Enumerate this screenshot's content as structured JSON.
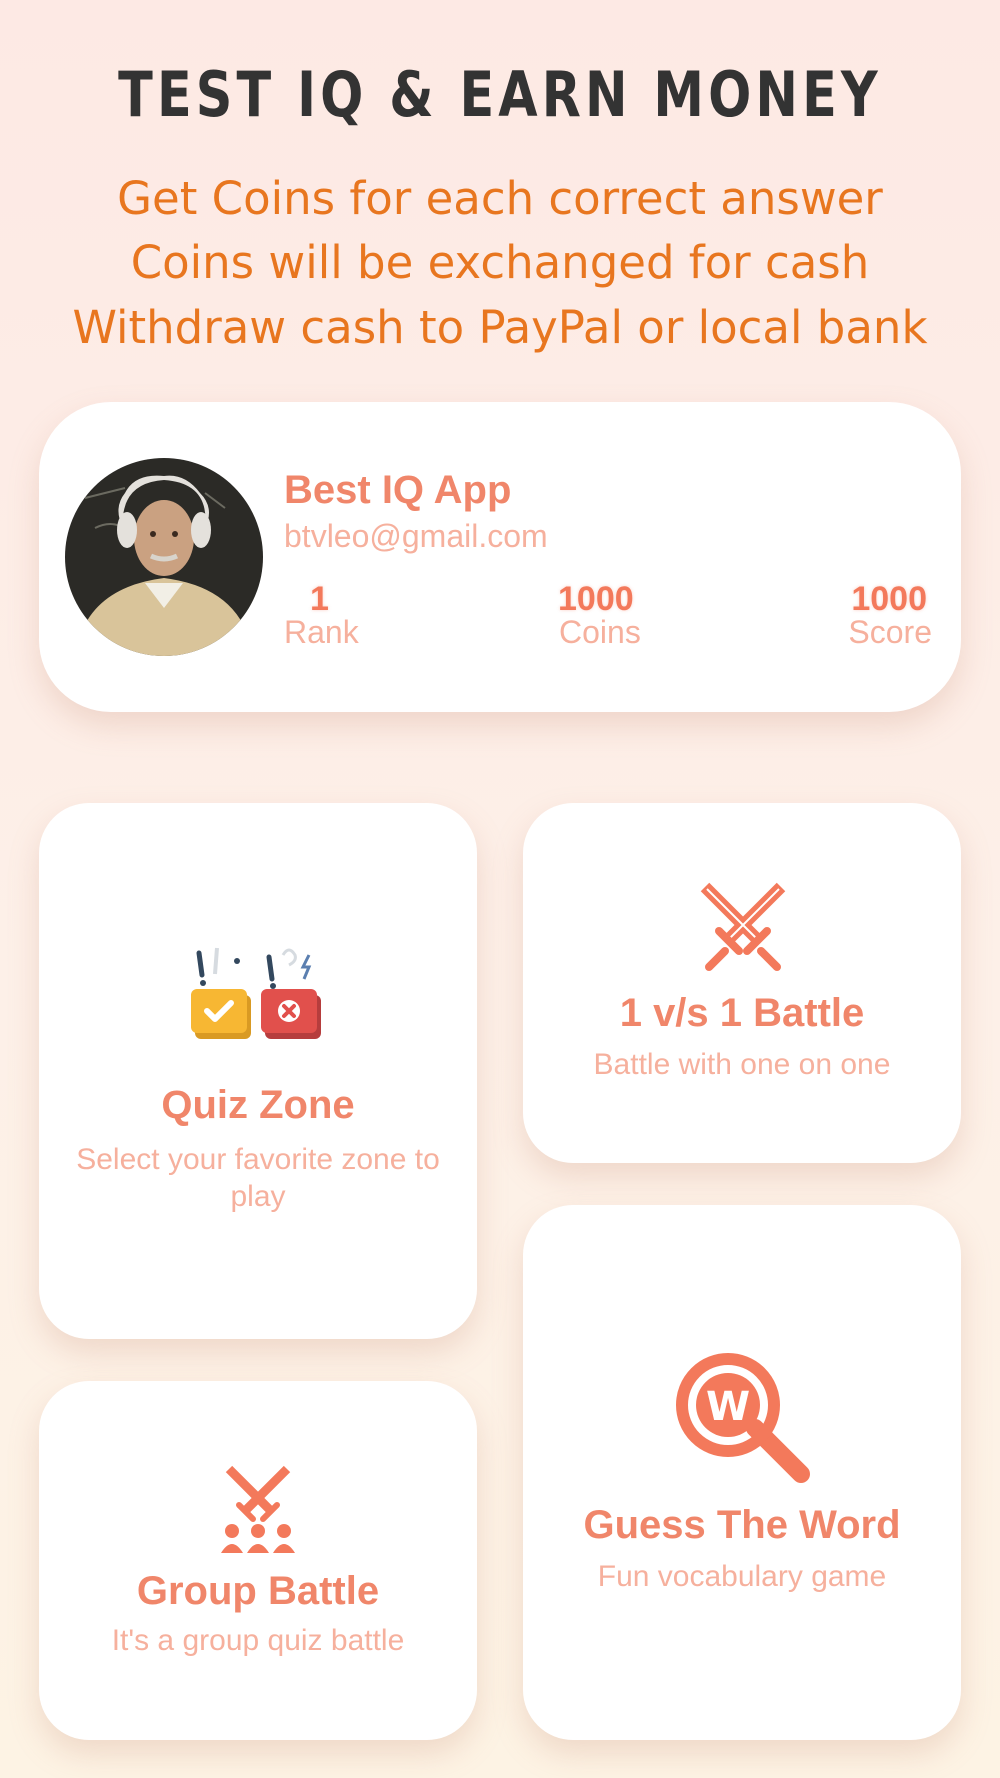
{
  "headline": "TEST IQ & EARN MONEY",
  "subheadlines": [
    "Get Coins for each correct answer",
    "Coins will be exchanged for cash",
    "Withdraw cash to PayPal or local bank"
  ],
  "profile": {
    "name": "Best IQ App",
    "email": "btvleo@gmail.com",
    "stats": {
      "rank": {
        "value": "1",
        "label": "Rank"
      },
      "coins": {
        "value": "1000",
        "label": "Coins"
      },
      "score": {
        "value": "1000",
        "label": "Score"
      }
    }
  },
  "tiles": {
    "quiz_zone": {
      "title": "Quiz Zone",
      "desc": "Select your favorite zone to play",
      "icon": "quiz-cards-icon"
    },
    "battle": {
      "title": "1 v/s 1 Battle",
      "desc": "Battle with one on one",
      "icon": "crossed-swords-icon"
    },
    "group_battle": {
      "title": "Group Battle",
      "desc": "It's a group quiz battle",
      "icon": "group-swords-icon"
    },
    "guess_word": {
      "title": "Guess The Word",
      "desc": "Fun vocabulary game",
      "icon": "magnifier-w-icon",
      "icon_letter": "W"
    }
  },
  "colors": {
    "accent": "#f3795b",
    "headline": "#333333",
    "subheadline": "#e8761f",
    "muted": "#f6b09d"
  }
}
